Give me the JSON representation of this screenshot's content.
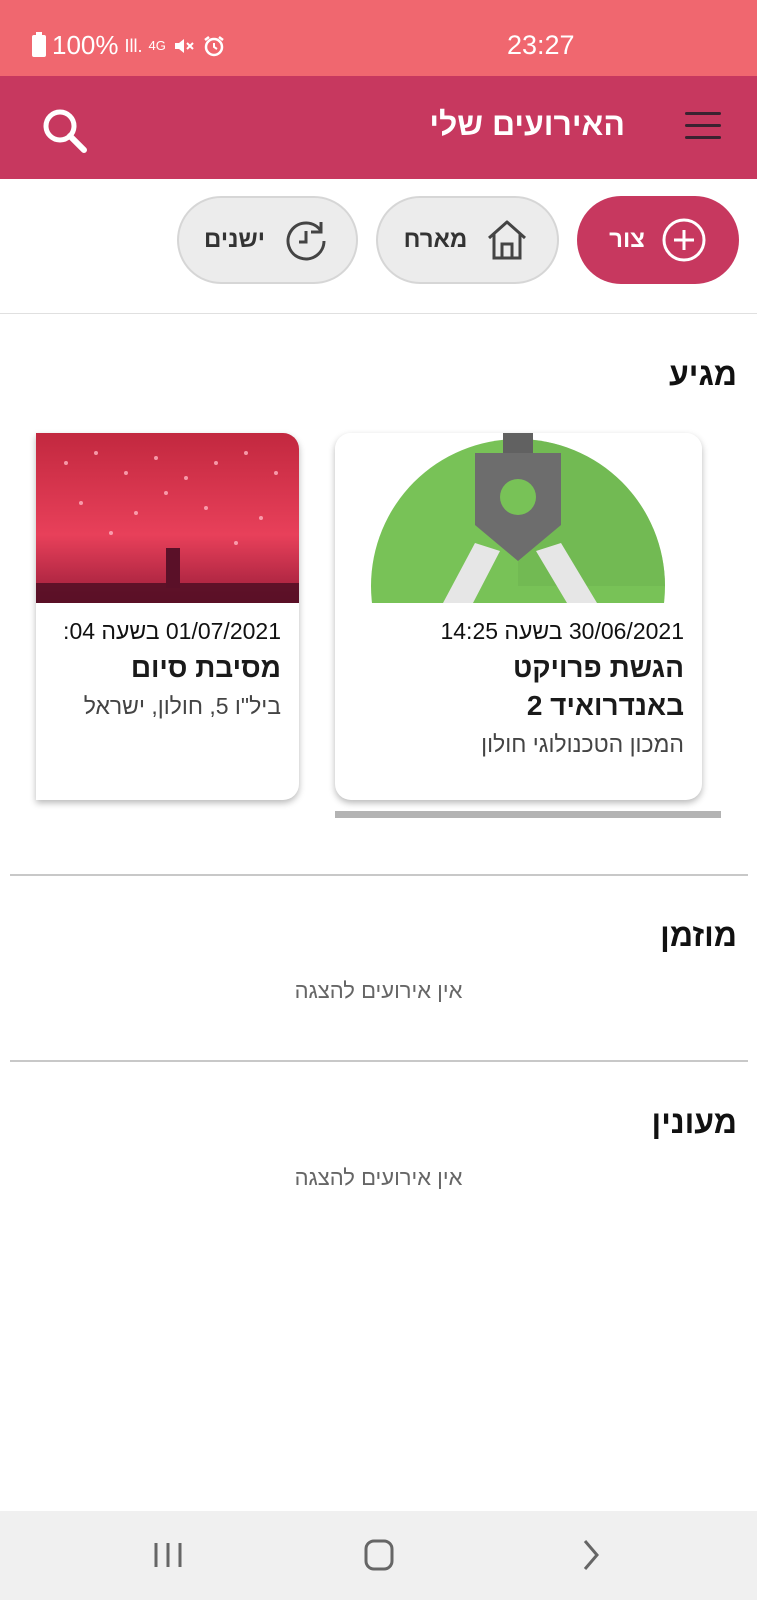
{
  "status_bar": {
    "battery": "100%",
    "signal_label": "Ill.",
    "network": "4G",
    "time": "23:27"
  },
  "app_bar": {
    "title": "האירועים שלי",
    "search_icon": "search-icon",
    "menu_icon": "hamburger-menu-icon"
  },
  "filters": {
    "create": {
      "label": "צור",
      "icon": "plus-circle-icon"
    },
    "host": {
      "label": "מארח",
      "icon": "home-icon"
    },
    "old": {
      "label": "ישנים",
      "icon": "history-icon"
    }
  },
  "sections": {
    "upcoming": {
      "title": "מגיע",
      "events": [
        {
          "date": "30/06/2021 בשעה 14:25",
          "title": "הגשת פרויקט באנדרואיד 2",
          "location": "המכון הטכנולוגי חולון",
          "image": "android-studio-logo"
        },
        {
          "date": "01/07/2021 בשעה 04:",
          "title": "מסיבת סיום",
          "location": "ביל\"ו 5, חולון, ישראל",
          "image": "fireworks-photo"
        }
      ]
    },
    "invited": {
      "title": "מוזמן",
      "empty": "אין אירועים להצגה"
    },
    "interested": {
      "title": "מעונין",
      "empty": "אין אירועים להצגה"
    }
  },
  "colors": {
    "status_bar": "#f0676f",
    "app_bar": "#c7385f",
    "accent": "#c7385f",
    "chip_bg": "#ececec"
  },
  "nav_bar": {
    "recents_icon": "recents-icon",
    "home_icon": "home-circle-icon",
    "back_icon": "back-chevron-icon"
  }
}
